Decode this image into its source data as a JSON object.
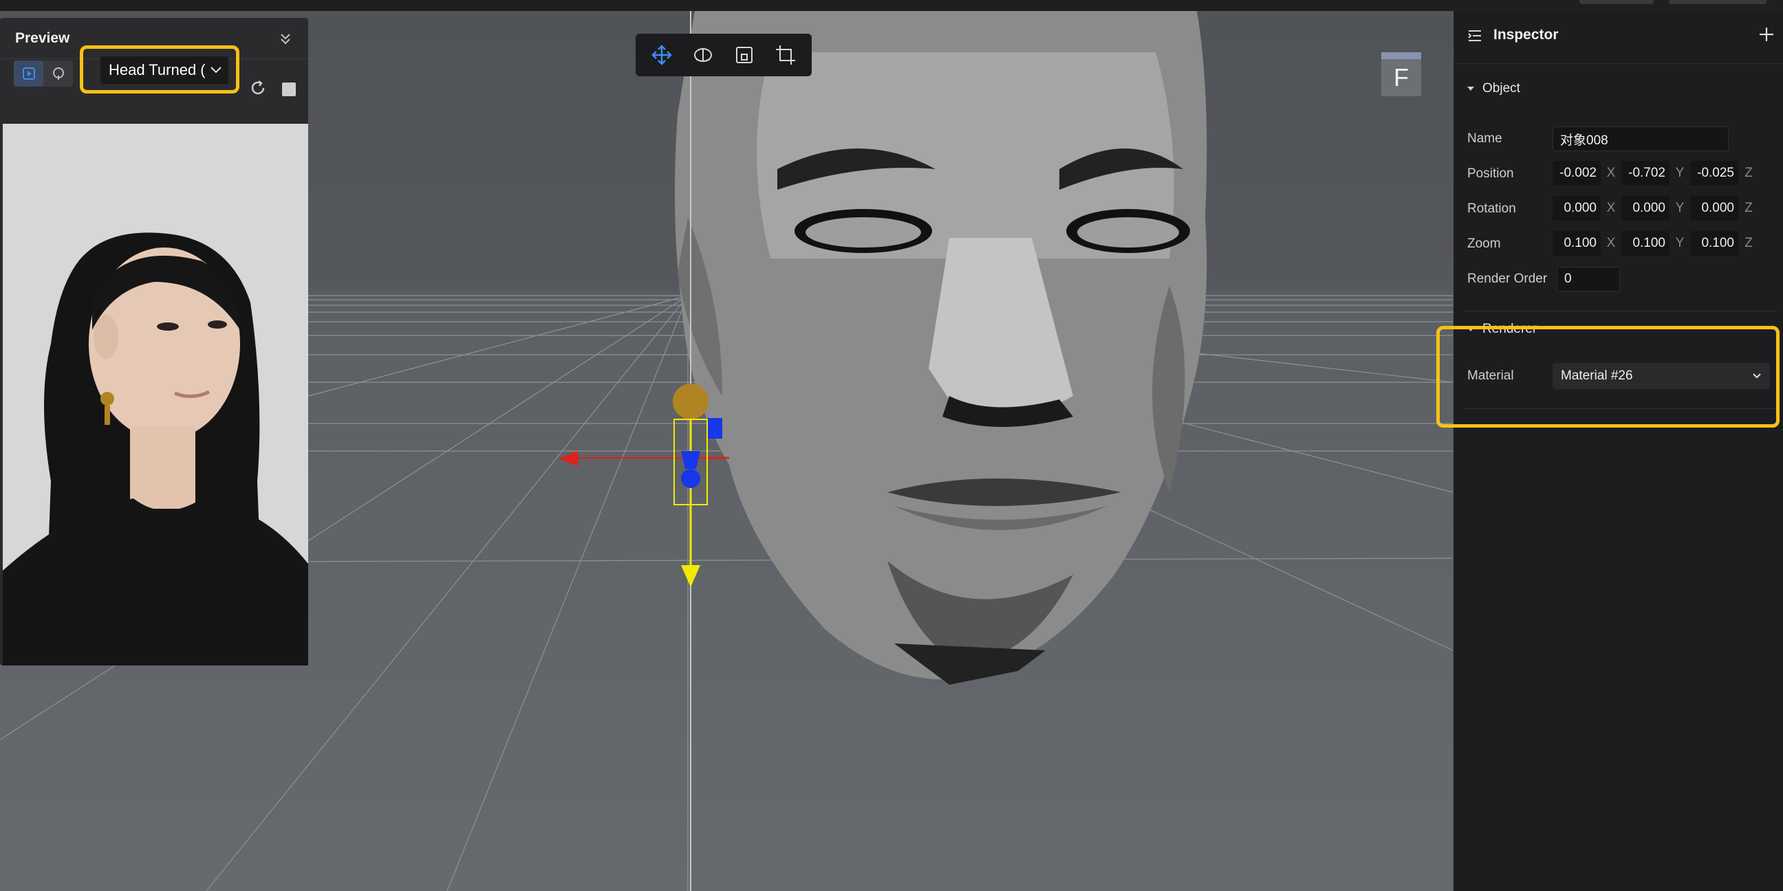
{
  "preview": {
    "title": "Preview",
    "animation_select": "Head Turned ("
  },
  "viewport": {
    "view_cube_label": "F",
    "toolbar_tools": [
      "move-tool",
      "rotate-tool",
      "scale-tool",
      "rect-tool"
    ]
  },
  "inspector": {
    "title": "Inspector",
    "object_section": "Object",
    "name_label": "Name",
    "name_value": "对象008",
    "position_label": "Position",
    "position": {
      "x": "-0.002",
      "y": "-0.702",
      "z": "-0.025"
    },
    "rotation_label": "Rotation",
    "rotation": {
      "x": "0.000",
      "y": "0.000",
      "z": "0.000"
    },
    "zoom_label": "Zoom",
    "zoom": {
      "x": "0.100",
      "y": "0.100",
      "z": "0.100"
    },
    "axis_labels": {
      "x": "X",
      "y": "Y",
      "z": "Z"
    },
    "render_order_label": "Render Order",
    "render_order_value": "0",
    "renderer_section": "Renderer",
    "material_label": "Material",
    "material_value": "Material #26"
  },
  "colors": {
    "highlight": "#f7c117",
    "accent_blue": "#3d8ef2",
    "gizmo_yellow": "#f2ea00",
    "gizmo_red": "#e0201a",
    "gizmo_blue": "#1638e8"
  }
}
